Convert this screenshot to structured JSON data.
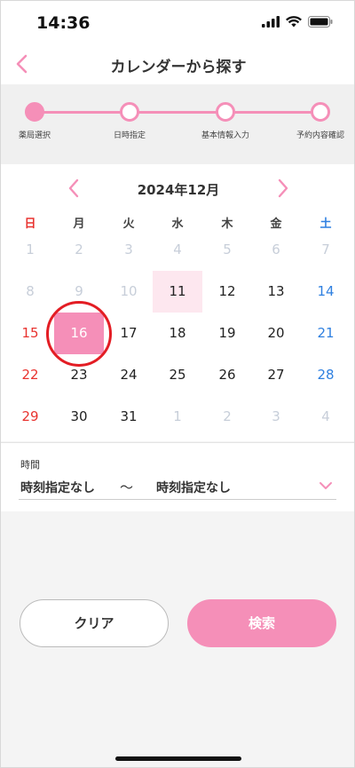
{
  "status": {
    "time": "14:36"
  },
  "header": {
    "title": "カレンダーから探す"
  },
  "stepper": {
    "steps": [
      {
        "label": "薬局選択",
        "done": true
      },
      {
        "label": "日時指定",
        "done": false
      },
      {
        "label": "基本情報入力",
        "done": false
      },
      {
        "label": "予約内容確認",
        "done": false
      }
    ]
  },
  "calendar": {
    "month_label": "2024年12月",
    "weekdays": [
      "日",
      "月",
      "火",
      "水",
      "木",
      "金",
      "土"
    ],
    "weeks": [
      [
        "1",
        "2",
        "3",
        "4",
        "5",
        "6",
        "7"
      ],
      [
        "8",
        "9",
        "10",
        "11",
        "12",
        "13",
        "14"
      ],
      [
        "15",
        "16",
        "17",
        "18",
        "19",
        "20",
        "21"
      ],
      [
        "22",
        "23",
        "24",
        "25",
        "26",
        "27",
        "28"
      ],
      [
        "29",
        "30",
        "31",
        "1",
        "2",
        "3",
        "4"
      ]
    ],
    "today": "11",
    "selected": "16"
  },
  "time": {
    "label": "時間",
    "from": "時刻指定なし",
    "separator": "〜",
    "to": "時刻指定なし"
  },
  "buttons": {
    "clear": "クリア",
    "search": "検索"
  },
  "colors": {
    "accent": "#f58fb8",
    "sunday": "#e8332f",
    "saturday": "#2f80e0",
    "ring": "#e31d24"
  }
}
